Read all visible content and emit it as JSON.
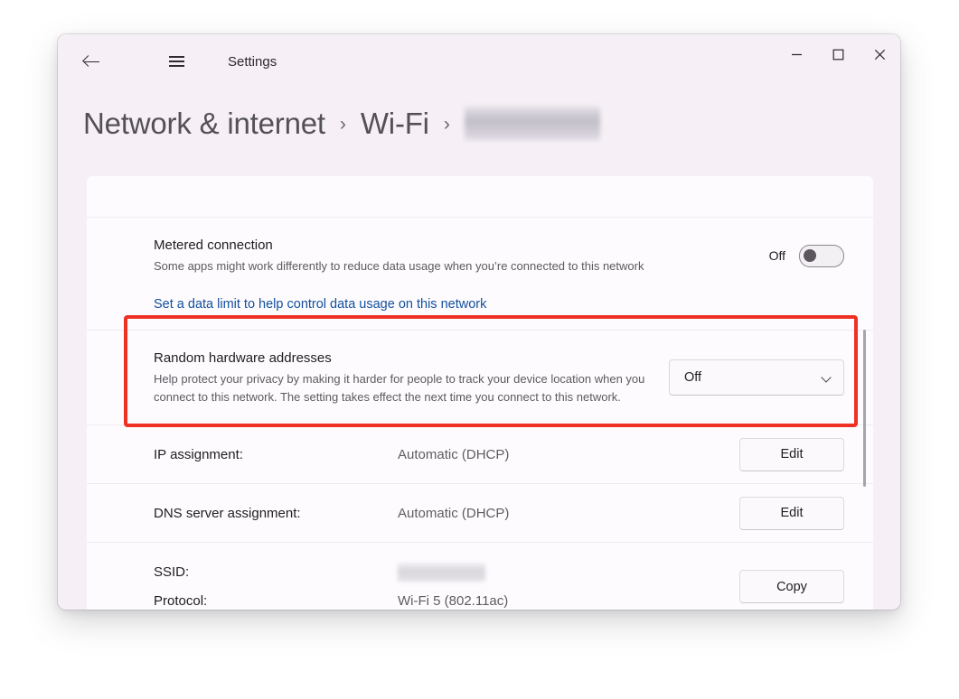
{
  "window": {
    "app_title": "Settings",
    "back_icon": "arrow-left-icon",
    "menu_icon": "hamburger-menu-icon",
    "controls": {
      "minimize": "minimize-icon",
      "maximize": "maximize-icon",
      "close": "close-icon"
    }
  },
  "breadcrumb": {
    "root": "Network & internet",
    "separator": "›",
    "level2": "Wi-Fi",
    "level3_redacted": true
  },
  "settings": {
    "metered": {
      "title": "Metered connection",
      "description": "Some apps might work differently to reduce data usage when you’re connected to this network",
      "toggle_state_label": "Off",
      "toggle_on": false
    },
    "data_limit_link": "Set a data limit to help control data usage on this network",
    "random_hardware": {
      "title": "Random hardware addresses",
      "description": "Help protect your privacy by making it harder for people to track your device location when you connect to this network. The setting takes effect the next time you connect to this network.",
      "dropdown_value": "Off",
      "dropdown_icon": "chevron-down-icon",
      "highlighted": true,
      "highlight_color": "#ee3124"
    },
    "ip_assignment": {
      "label": "IP assignment:",
      "value": "Automatic (DHCP)",
      "button": "Edit"
    },
    "dns_assignment": {
      "label": "DNS server assignment:",
      "value": "Automatic (DHCP)",
      "button": "Edit"
    },
    "network_details": {
      "ssid_label": "SSID:",
      "ssid_value_redacted": true,
      "protocol_label": "Protocol:",
      "protocol_value": "Wi-Fi 5 (802.11ac)",
      "button": "Copy"
    }
  },
  "colors": {
    "header_background": "#f6f0f6",
    "panel_background": "#fdfbfd",
    "link": "#13509e",
    "highlight": "#ee3124"
  }
}
